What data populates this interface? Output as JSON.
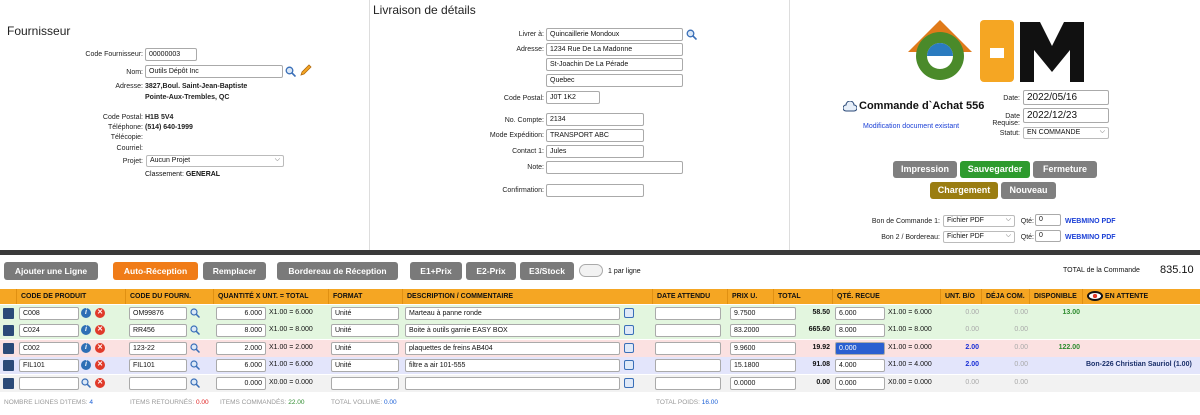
{
  "supplier": {
    "title": "Fournisseur",
    "code_label": "Code Fournisseur:",
    "code": "00000003",
    "name_label": "Nom:",
    "name": "Outils Dépôt Inc",
    "address_label": "Adresse:",
    "address1": "3827,Boul. Saint-Jean-Baptiste",
    "address2": "Pointe-Aux-Trembles, QC",
    "postal_label": "Code Postal:",
    "postal": "H1B 5V4",
    "phone_label": "Téléphone:",
    "phone": "(514) 640-1999",
    "fax_label": "Télécopie:",
    "email_label": "Courriel:",
    "project_label": "Projet:",
    "project": "Aucun Projet",
    "class_label": "Classement:",
    "class": "GENERAL"
  },
  "delivery": {
    "title": "Livraison de détails",
    "deliver_label": "Livrer à:",
    "deliver": "Quincaillerie Mondoux",
    "address_label": "Adresse:",
    "addr1": "1234 Rue De La Madonne",
    "addr2": "St-Joachin De La Pérade",
    "addr3": "Quebec",
    "postal_label": "Code Postal:",
    "postal": "J0T 1K2",
    "account_label": "No. Compte:",
    "account": "2134",
    "ship_label": "Mode Expédition:",
    "ship": "TRANSPORT ABC",
    "contact_label": "Contact 1:",
    "contact": "Jules",
    "note_label": "Note:",
    "note": "",
    "confirm_label": "Confirmation:",
    "confirm": ""
  },
  "order": {
    "title": "Commande d`Achat 556",
    "subtitle": "Modification document existant",
    "date_label": "Date:",
    "date": "2022/05/16",
    "req_label": "Date Requise:",
    "req": "2022/12/23",
    "status_label": "Statut:",
    "status": "EN COMMANDE",
    "btn_print": "Impression",
    "btn_save": "Sauvegarder",
    "btn_close": "Fermeture",
    "btn_load": "Chargement",
    "btn_new": "Nouveau",
    "bon1_label": "Bon de Commande 1:",
    "bon1_fmt": "Fichier PDF",
    "bon2_label": "Bon 2 / Bordereau:",
    "bon2_fmt": "Fichier PDF",
    "qty_label": "Qté:",
    "qty1": "0",
    "qty2": "0",
    "webmino": "WEBMINO PDF"
  },
  "colors": {
    "accent": "#f5a623",
    "save": "#2e9b2e",
    "load": "#9a7d12",
    "reception": "#f07c18"
  },
  "toolbar": {
    "add_line": "Ajouter une Ligne",
    "auto_reception": "Auto-Réception",
    "replace": "Remplacer",
    "bordereau": "Bordereau de Réception",
    "e1": "E1+Prix",
    "e2": "E2-Prix",
    "e3": "E3/Stock",
    "per_line": "1 par ligne",
    "total_label": "TOTAL de la Commande",
    "total": "835.10"
  },
  "columns": [
    "CODE DE PRODUIT",
    "CODE DU FOURN.",
    "QUANTITÉ X UNT. = TOTAL",
    "FORMAT",
    "DESCRIPTION / COMMENTAIRE",
    "DATE ATTENDU",
    "PRIX U.",
    "TOTAL",
    "QTÉ. RECUE",
    "UNT. B/O",
    "DÉJA COM.",
    "DISPONIBLE",
    "EN ATTENTE"
  ],
  "rows": [
    {
      "prod": "C008",
      "fourn": "OM99876",
      "qty": "6.000",
      "calc": "X1.00 = 6.000",
      "fmt": "Unité",
      "desc": "Marteau à panne ronde",
      "date": "",
      "price": "9.7500",
      "total": "58.50",
      "recv": "6.000",
      "recv_calc": "X1.00 = 6.000",
      "bo": "0.00",
      "deja": "0.00",
      "dispo": "13.00",
      "attente": ""
    },
    {
      "prod": "C024",
      "fourn": "RR456",
      "qty": "8.000",
      "calc": "X1.00 = 8.000",
      "fmt": "Unité",
      "desc": "Boite à outils garnie EASY BOX",
      "date": "",
      "price": "83.2000",
      "total": "665.60",
      "recv": "8.000",
      "recv_calc": "X1.00 = 8.000",
      "bo": "0.00",
      "deja": "0.00",
      "dispo": "",
      "attente": ""
    },
    {
      "prod": "C002",
      "fourn": "123-22",
      "qty": "2.000",
      "calc": "X1.00 = 2.000",
      "fmt": "Unité",
      "desc": "plaquettes de freins AB404",
      "date": "",
      "price": "9.9600",
      "total": "19.92",
      "recv": "0.000",
      "recv_calc": "X1.00 = 0.000",
      "bo": "2.00",
      "deja": "0.00",
      "dispo": "122.00",
      "attente": ""
    },
    {
      "prod": "FIL101",
      "fourn": "FIL101",
      "qty": "6.000",
      "calc": "X1.00 = 6.000",
      "fmt": "Unité",
      "desc": "filtre a air 101-555",
      "date": "",
      "price": "15.1800",
      "total": "91.08",
      "recv": "4.000",
      "recv_calc": "X1.00 = 4.000",
      "bo": "2.00",
      "deja": "0.00",
      "dispo": "",
      "attente": "Bon-226 Christian Sauriol (1.00)"
    },
    {
      "prod": "",
      "fourn": "",
      "qty": "0.000",
      "calc": "X0.00 = 0.000",
      "fmt": "",
      "desc": "",
      "date": "",
      "price": "0.0000",
      "total": "0.00",
      "recv": "0.000",
      "recv_calc": "X0.00 = 0.000",
      "bo": "0.00",
      "deja": "0.00",
      "dispo": "",
      "attente": ""
    }
  ],
  "summary": {
    "lines_label": "NOMBRE LIGNES D'ITEMS:",
    "lines": "4",
    "returned_label": "ITEMS RETOURNÉS:",
    "returned": "0.00",
    "ordered_label": "ITEMS COMMANDÉS:",
    "ordered": "22.00",
    "volume_label": "TOTAL VOLUME:",
    "volume": "0.00",
    "weight_label": "TOTAL POIDS:",
    "weight": "16.00"
  }
}
